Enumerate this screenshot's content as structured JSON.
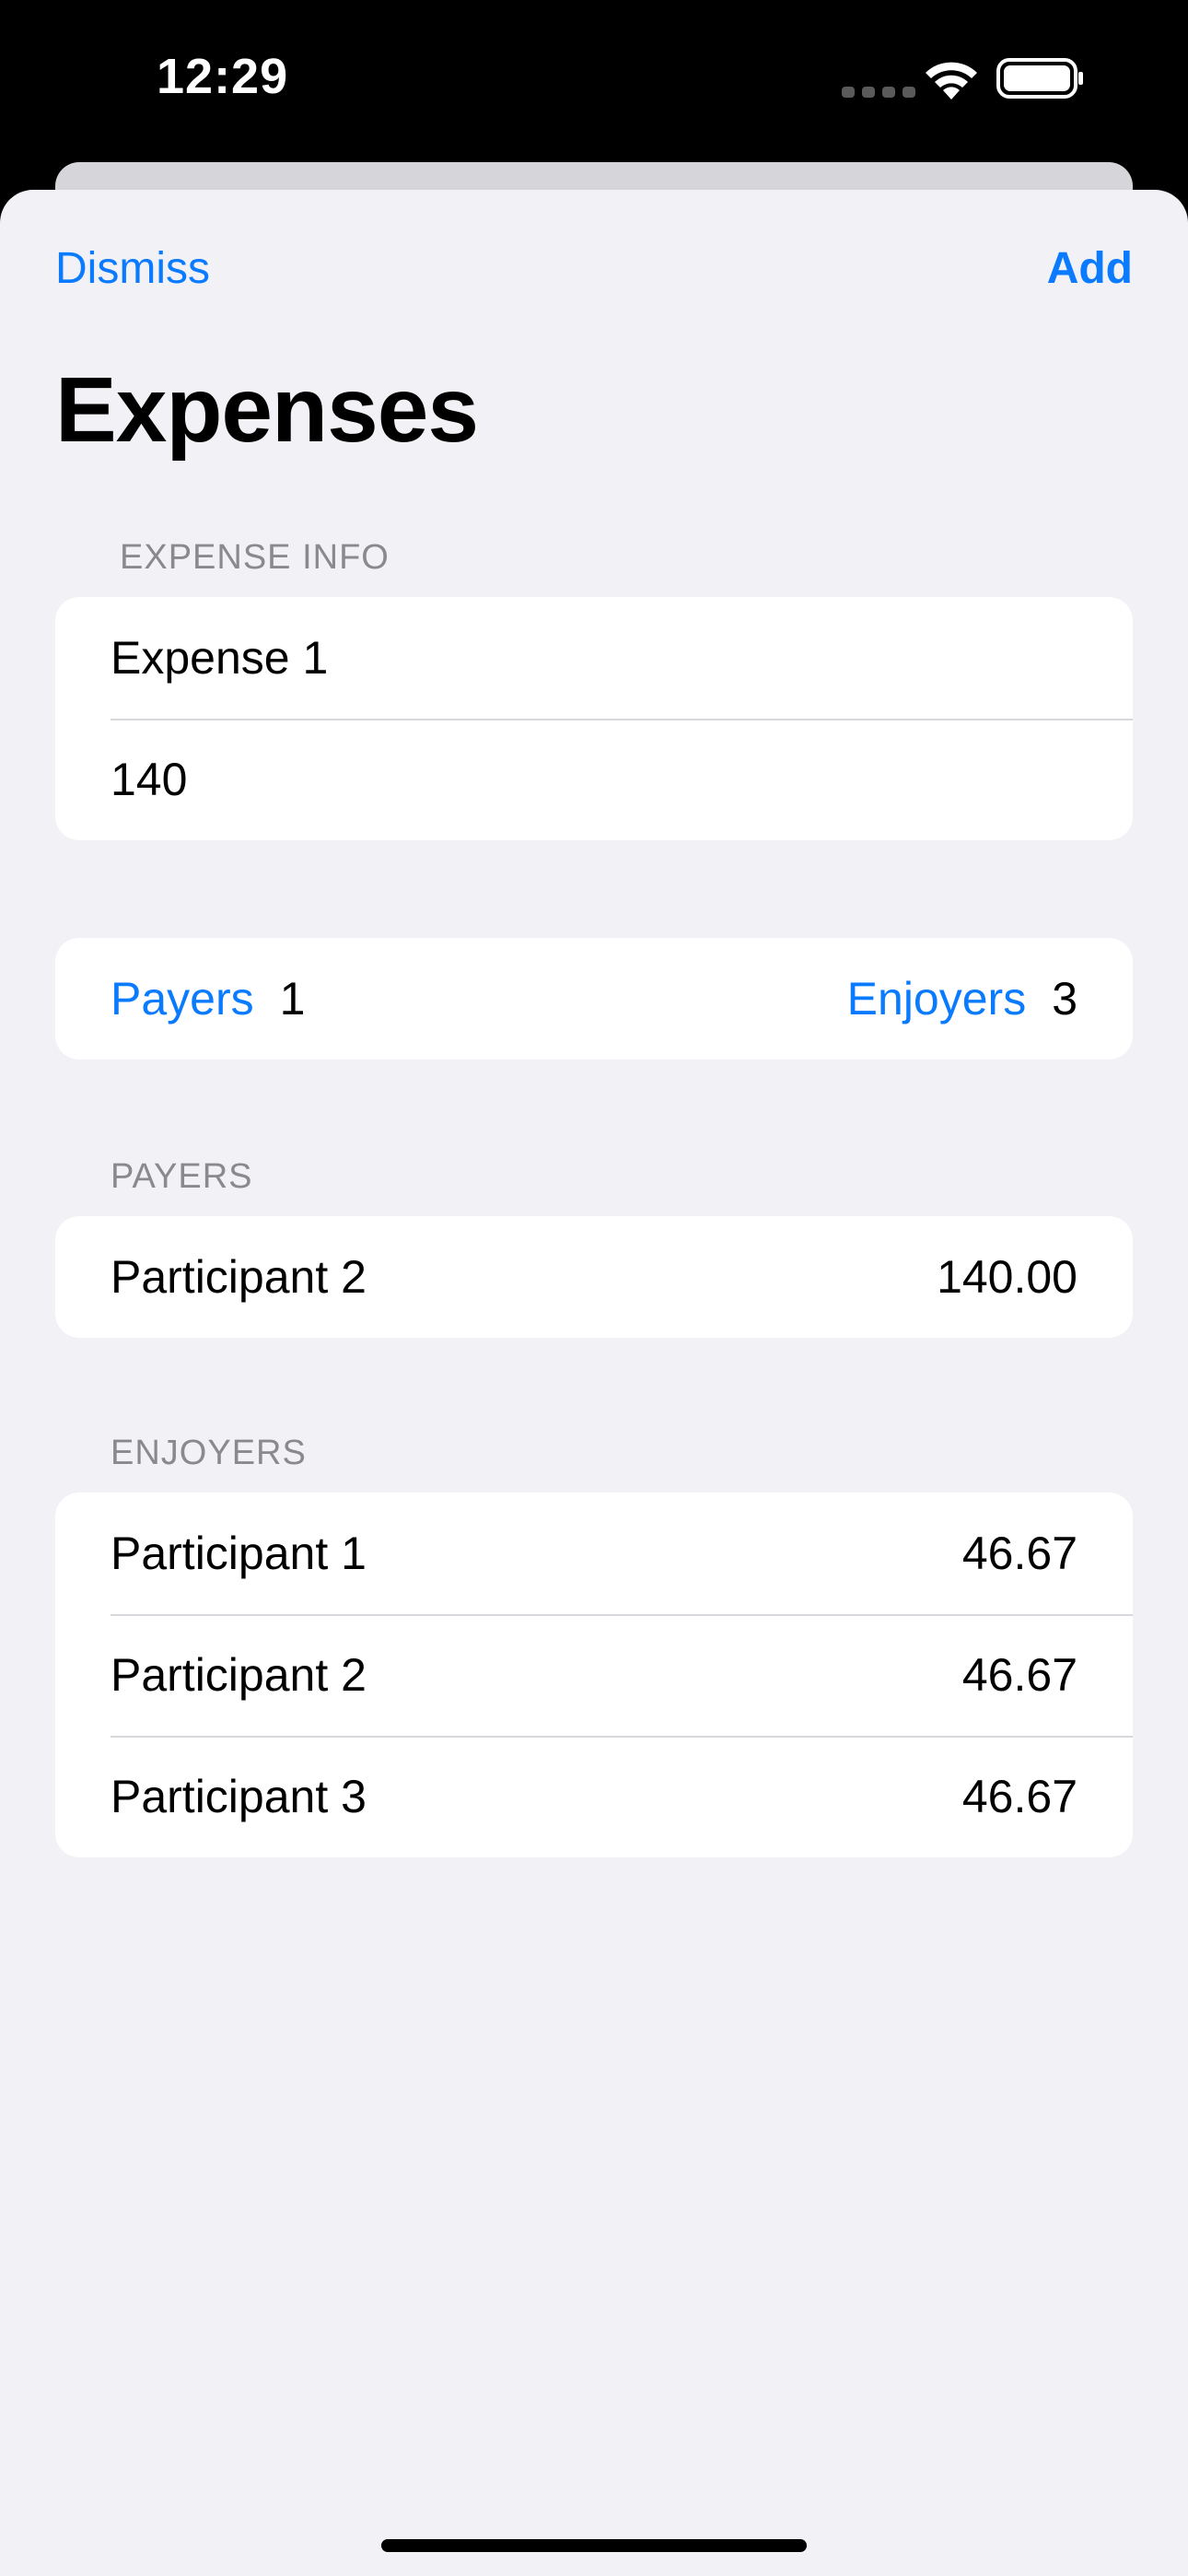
{
  "status_bar": {
    "time": "12:29",
    "icons": [
      "cellular-icon",
      "wifi-icon",
      "battery-icon"
    ]
  },
  "nav": {
    "dismiss_label": "Dismiss",
    "add_label": "Add"
  },
  "page": {
    "title": "Expenses"
  },
  "expense_info": {
    "header": "EXPENSE INFO",
    "name_value": "Expense 1",
    "amount_value": "140"
  },
  "counts": {
    "payers_label": "Payers",
    "payers_count": "1",
    "enjoyers_label": "Enjoyers",
    "enjoyers_count": "3"
  },
  "payers": {
    "header": "PAYERS",
    "rows": [
      {
        "name": "Participant 2",
        "amount": "140.00"
      }
    ]
  },
  "enjoyers": {
    "header": "ENJOYERS",
    "rows": [
      {
        "name": "Participant 1",
        "amount": "46.67"
      },
      {
        "name": "Participant 2",
        "amount": "46.67"
      },
      {
        "name": "Participant 3",
        "amount": "46.67"
      }
    ]
  },
  "colors": {
    "accent": "#0a7aff",
    "sheet_background": "#f1f1f6",
    "section_header": "#8a8a8e"
  }
}
